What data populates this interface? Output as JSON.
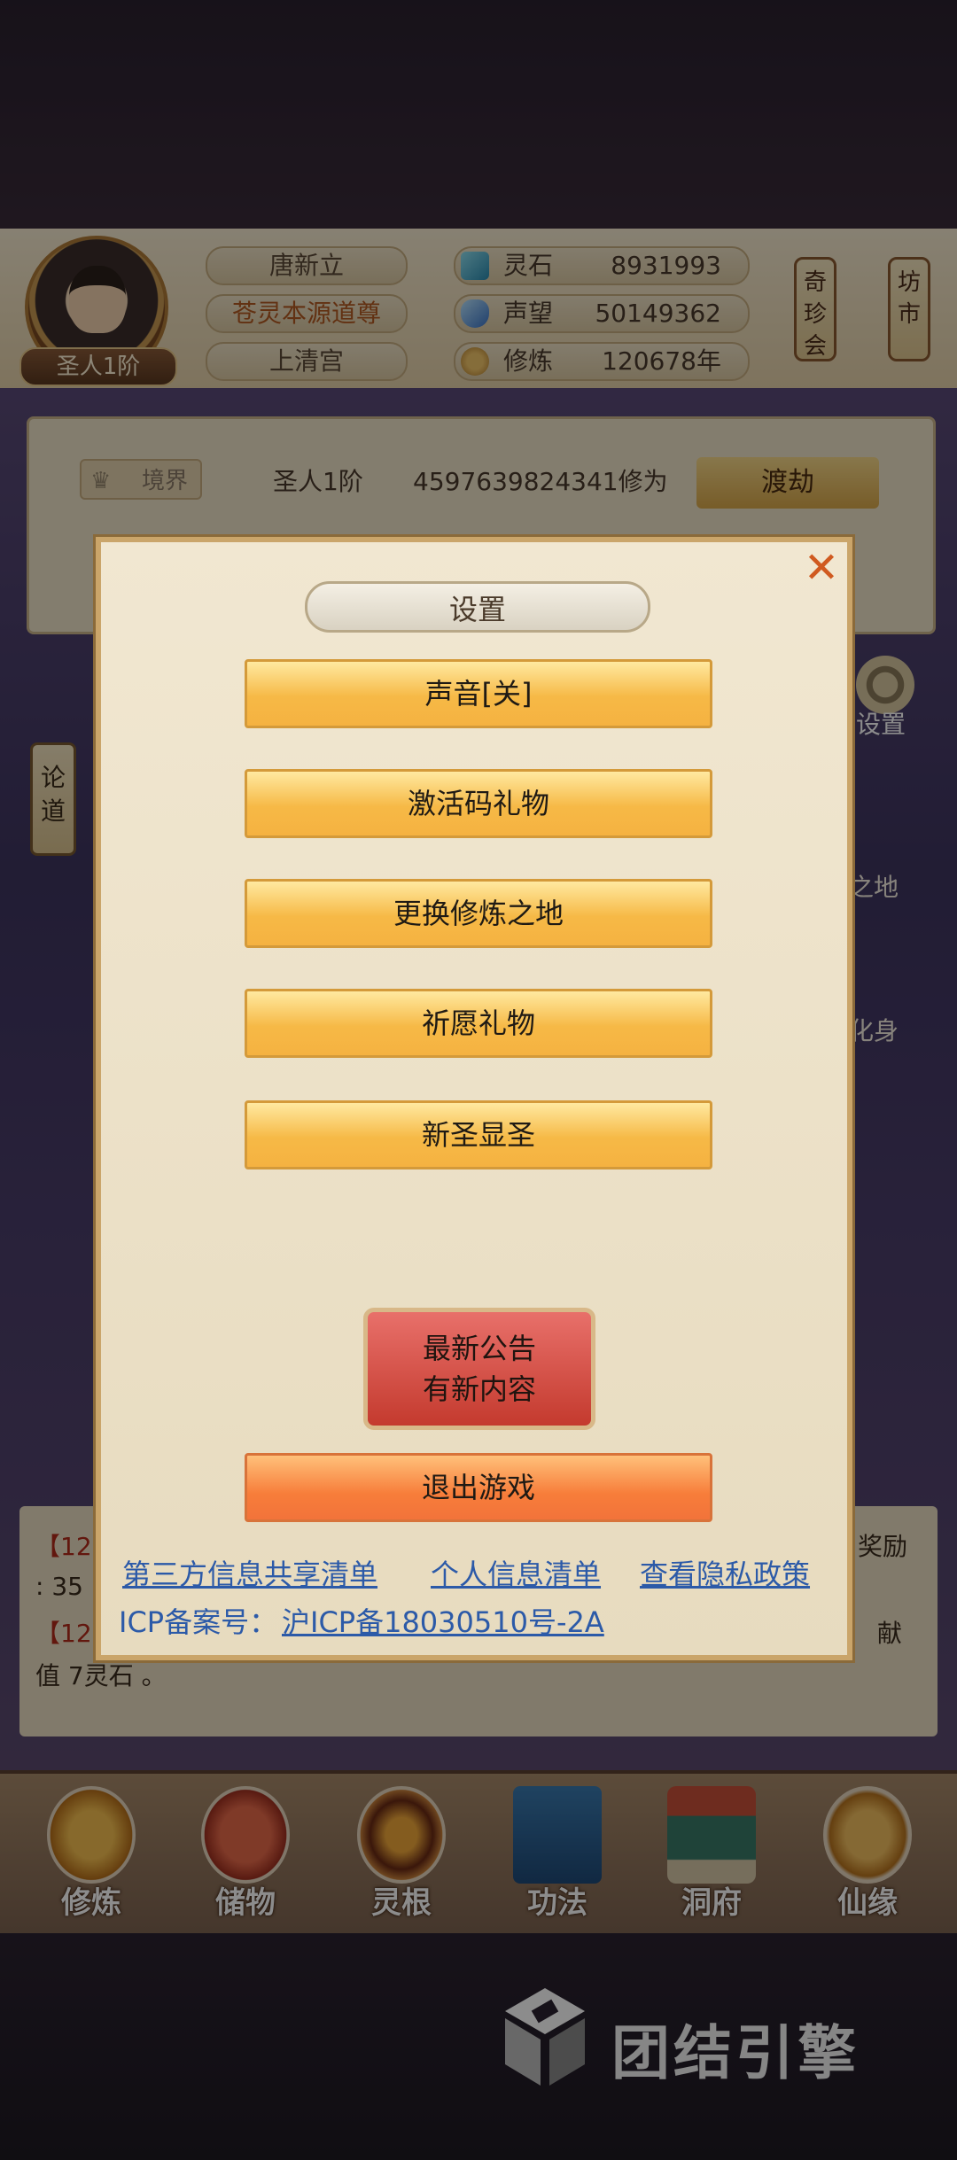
{
  "header": {
    "rank_badge": "圣人1阶",
    "player_name": "唐新立",
    "title": "苍灵本源道尊",
    "sect": "上清宫",
    "stats": [
      {
        "icon": "spirit-stone-icon",
        "label": "灵石",
        "value": "8931993"
      },
      {
        "icon": "reputation-icon",
        "label": "声望",
        "value": "50149362"
      },
      {
        "icon": "cultivation-icon",
        "label": "修炼",
        "value": "120678年"
      }
    ],
    "rare_treasure_label": "奇珍会",
    "market_label": "坊市"
  },
  "realm": {
    "tag": "境界",
    "rank": "圣人1阶",
    "exp": "4597639824341修为",
    "dujie_label": "渡劫"
  },
  "side": {
    "lundao": "论道",
    "settings": "设置",
    "place": "之地",
    "avatar": "化身"
  },
  "log": {
    "line1_prefix": "【12",
    "line1_suffix": "奖励",
    "line2": ": 35",
    "line3_prefix": "【12",
    "line3_suffix": "献",
    "line4": "值 7灵石 。"
  },
  "dialog": {
    "title": "设置",
    "close": "✕",
    "buttons": [
      "声音[关]",
      "激活码礼物",
      "更换修炼之地",
      "祈愿礼物",
      "新圣显圣"
    ],
    "notice_line1": "最新公告",
    "notice_line2": "有新内容",
    "quit": "退出游戏",
    "links": [
      "第三方信息共享清单",
      "个人信息清单",
      "查看隐私政策"
    ],
    "icp_label": "ICP备案号：",
    "icp_number": "沪ICP备18030510号-2A"
  },
  "nav": [
    {
      "label": "修炼",
      "icon": "cultivate-icon"
    },
    {
      "label": "储物",
      "icon": "storage-bag-icon"
    },
    {
      "label": "灵根",
      "icon": "spirit-root-icon"
    },
    {
      "label": "功法",
      "icon": "manual-book-icon"
    },
    {
      "label": "洞府",
      "icon": "cave-dwelling-icon"
    },
    {
      "label": "仙缘",
      "icon": "immortal-fate-icon"
    }
  ],
  "engine": {
    "name": "团结引擎"
  }
}
